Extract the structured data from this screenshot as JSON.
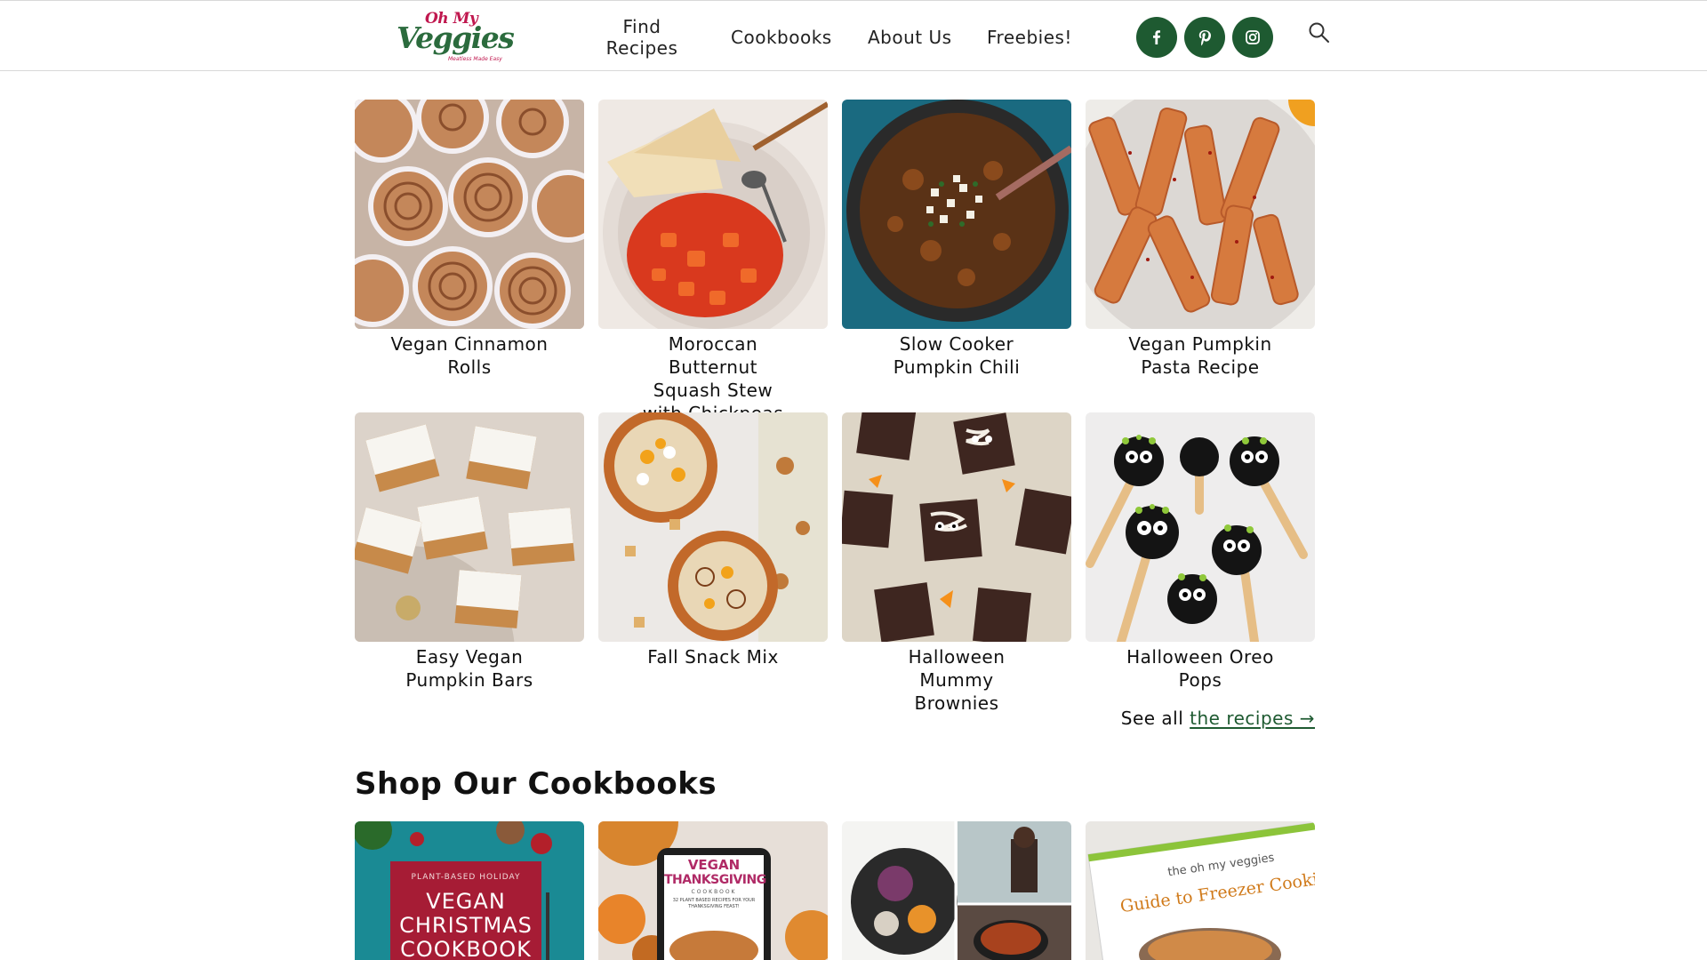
{
  "logo": {
    "top": "Oh My",
    "main": "Veggies",
    "tagline": "Meatless Made Easy"
  },
  "nav": {
    "find_recipes": [
      "Find",
      "Recipes"
    ],
    "cookbooks": "Cookbooks",
    "about": "About Us",
    "freebies": "Freebies!"
  },
  "social": [
    "facebook-icon",
    "pinterest-icon",
    "instagram-icon"
  ],
  "brand_color": "#1e5a31",
  "recipes": [
    {
      "title": "Vegan Cinnamon Rolls"
    },
    {
      "title": "Moroccan Butternut Squash Stew with Chickpeas"
    },
    {
      "title": "Slow Cooker Pumpkin Chili"
    },
    {
      "title": "Vegan Pumpkin Pasta Recipe"
    },
    {
      "title": "Easy Vegan Pumpkin Bars"
    },
    {
      "title": "Fall Snack Mix"
    },
    {
      "title": "Halloween Mummy Brownies"
    },
    {
      "title": "Halloween Oreo Pops"
    }
  ],
  "see_all": {
    "prefix": "See all",
    "link": "the recipes →"
  },
  "cookbooks": {
    "heading": "Shop Our Cookbooks",
    "items": [
      {
        "lines": [
          "PLANT-BASED HOLIDAY",
          "VEGAN",
          "CHRISTMAS",
          "COOKBOOK"
        ]
      },
      {
        "lines": [
          "VEGAN",
          "THANKSGIVING",
          "COOKBOOK",
          "32 PLANT BASED RECIPES FOR YOUR THANKSGIVING FEAST!"
        ]
      },
      {
        "lines": []
      },
      {
        "lines": [
          "the oh my veggies",
          "Guide to Freezer Cooking"
        ]
      }
    ]
  }
}
